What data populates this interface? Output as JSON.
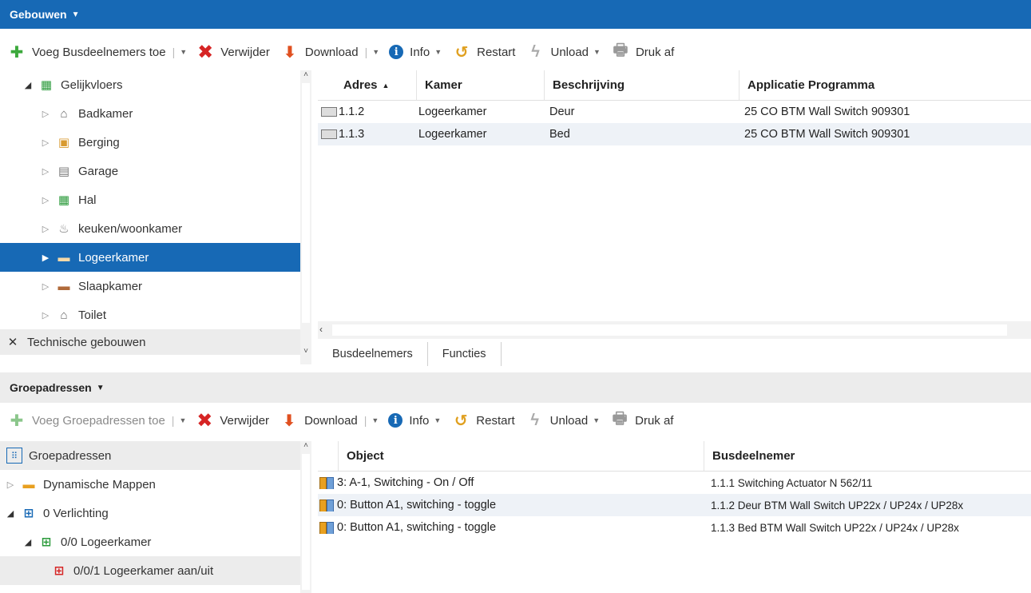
{
  "buildings_panel": {
    "title": "Gebouwen",
    "toolbar": {
      "add_label": "Voeg Busdeelnemers toe",
      "delete_label": "Verwijder",
      "download_label": "Download",
      "info_label": "Info",
      "restart_label": "Restart",
      "unload_label": "Unload",
      "print_label": "Druk af"
    },
    "tree": [
      {
        "label": "Gelijkvloers",
        "icon": "floor-icon"
      },
      {
        "label": "Badkamer",
        "icon": "bathroom-icon"
      },
      {
        "label": "Berging",
        "icon": "storage-icon"
      },
      {
        "label": "Garage",
        "icon": "garage-icon"
      },
      {
        "label": "Hal",
        "icon": "hall-icon"
      },
      {
        "label": "keuken/woonkamer",
        "icon": "kitchen-icon"
      },
      {
        "label": "Logeerkamer",
        "icon": "bedroom-icon"
      },
      {
        "label": "Slaapkamer",
        "icon": "bedroom-icon"
      },
      {
        "label": "Toilet",
        "icon": "toilet-icon"
      },
      {
        "label": "Technische gebouwen",
        "icon": "tools-icon"
      }
    ],
    "grid": {
      "columns": [
        "Adres",
        "Kamer",
        "Beschrijving",
        "Applicatie Programma"
      ],
      "rows": [
        [
          "1.1.2",
          "Logeerkamer",
          "Deur",
          "25 CO BTM Wall Switch 909301"
        ],
        [
          "1.1.3",
          "Logeerkamer",
          "Bed",
          "25 CO BTM Wall Switch 909301"
        ]
      ]
    },
    "tabs": [
      "Busdeelnemers",
      "Functies"
    ]
  },
  "group_panel": {
    "title": "Groepadressen",
    "toolbar": {
      "add_label": "Voeg Groepadressen toe",
      "delete_label": "Verwijder",
      "download_label": "Download",
      "info_label": "Info",
      "restart_label": "Restart",
      "unload_label": "Unload",
      "print_label": "Druk af"
    },
    "tree": [
      {
        "label": "Groepadressen"
      },
      {
        "label": "Dynamische Mappen"
      },
      {
        "label": "0 Verlichting"
      },
      {
        "label": "0/0 Logeerkamer"
      },
      {
        "label": "0/0/1 Logeerkamer aan/uit"
      }
    ],
    "grid": {
      "columns": [
        "Object",
        "Busdeelnemer"
      ],
      "rows": [
        [
          "3: A-1, Switching - On / Off",
          "1.1.1 Switching Actuator N 562/11"
        ],
        [
          "0: Button A1, switching - toggle",
          "1.1.2 Deur BTM Wall Switch UP22x / UP24x / UP28x"
        ],
        [
          "0: Button A1, switching - toggle",
          "1.1.3 Bed BTM Wall Switch UP22x / UP24x / UP28x"
        ]
      ]
    }
  },
  "colors": {
    "accent": "#1769b5",
    "header_gray": "#ececec"
  }
}
